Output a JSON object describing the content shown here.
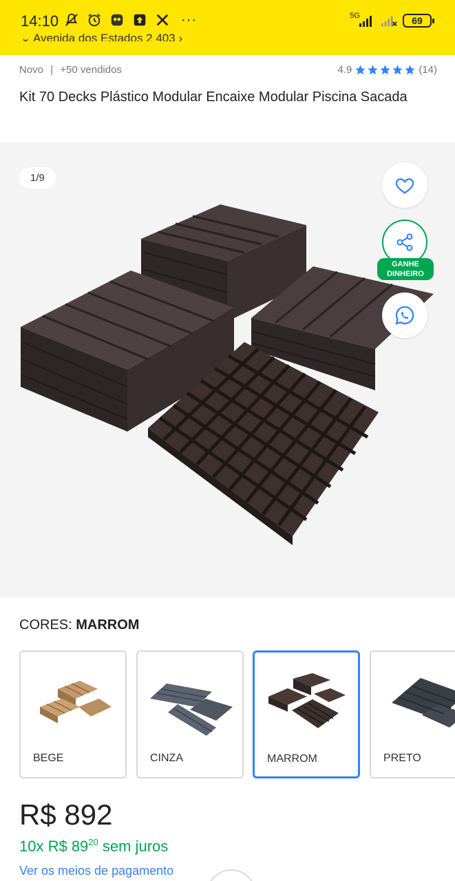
{
  "status_bar": {
    "time": "14:10",
    "dots": "···",
    "network": "5G",
    "battery": "69",
    "icons": [
      "mute-icon",
      "alarm-icon",
      "owl-icon",
      "upload-icon",
      "x-icon",
      "signal-icon",
      "signal-weak-icon"
    ]
  },
  "address_peek": "Avenida dos Estados 2 403",
  "product": {
    "condition": "Novo",
    "separator": "|",
    "sold": "+50 vendidos",
    "rating": "4.9",
    "rating_stars": 5,
    "reviews": "(14)",
    "title": "Kit 70 Decks Plástico Modular Encaixe Modular Piscina Sacada"
  },
  "gallery": {
    "counter": "1/9",
    "favorite_icon": "heart-icon",
    "share_icon": "share-icon",
    "share_badge_line1": "GANHE",
    "share_badge_line2": "DINHEIRO",
    "whatsapp_icon": "whatsapp-icon"
  },
  "colors_section": {
    "label": "CORES:",
    "selected": "MARROM",
    "options": [
      {
        "label": "BEGE",
        "swatch": "#c49a6c"
      },
      {
        "label": "CINZA",
        "swatch": "#5b6470"
      },
      {
        "label": "MARROM",
        "swatch": "#4a3a36"
      },
      {
        "label": "PRETO",
        "swatch": "#3a3f47"
      }
    ]
  },
  "pricing": {
    "price": "R$ 892",
    "installments_prefix": "10x R$ 89",
    "installments_cents": "20",
    "installments_suffix": "sem juros",
    "payment_link": "Ver os meios de pagamento"
  },
  "colors": {
    "brand_yellow": "#FFE600",
    "accent_blue": "#3483fa",
    "success_green": "#00a650"
  }
}
